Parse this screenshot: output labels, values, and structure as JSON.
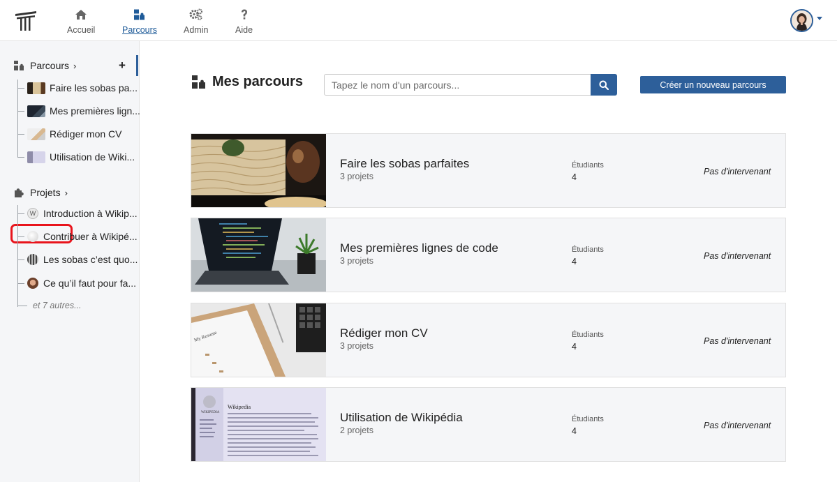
{
  "nav": {
    "items": [
      {
        "label": "Accueil",
        "icon": "home-icon"
      },
      {
        "label": "Parcours",
        "icon": "puzzle-path-icon",
        "active": true
      },
      {
        "label": "Admin",
        "icon": "gears-icon"
      },
      {
        "label": "Aide",
        "icon": "question-icon"
      }
    ]
  },
  "sidebar": {
    "parcours_label": "Parcours",
    "parcours_items": [
      "Faire les sobas pa...",
      "Mes premières lign...",
      "Rédiger mon CV",
      "Utilisation de Wiki..."
    ],
    "projets_label": "Projets",
    "projets_items": [
      "Introduction à Wikip...",
      "Contribuer à Wikipé...",
      "Les sobas c’est quo...",
      "Ce qu’il faut pour fa..."
    ],
    "more_label": "et 7 autres..."
  },
  "main": {
    "title": "Mes parcours",
    "search_placeholder": "Tapez le nom d'un parcours...",
    "create_button": "Créer un nouveau parcours",
    "cards": [
      {
        "title": "Faire les sobas parfaites",
        "projects": "3 projets",
        "students_label": "Étudiants",
        "students": "4",
        "intervenant": "Pas d'intervenant"
      },
      {
        "title": "Mes premières lignes de code",
        "projects": "3 projets",
        "students_label": "Étudiants",
        "students": "4",
        "intervenant": "Pas d'intervenant"
      },
      {
        "title": "Rédiger mon CV",
        "projects": "3 projets",
        "students_label": "Étudiants",
        "students": "4",
        "intervenant": "Pas d'intervenant"
      },
      {
        "title": "Utilisation de Wikipédia",
        "projects": "2 projets",
        "students_label": "Étudiants",
        "students": "4",
        "intervenant": "Pas d'intervenant"
      }
    ]
  },
  "colors": {
    "accent": "#2d5f9a",
    "highlight": "#e8141c",
    "sidebar_bg": "#f5f6f8"
  }
}
